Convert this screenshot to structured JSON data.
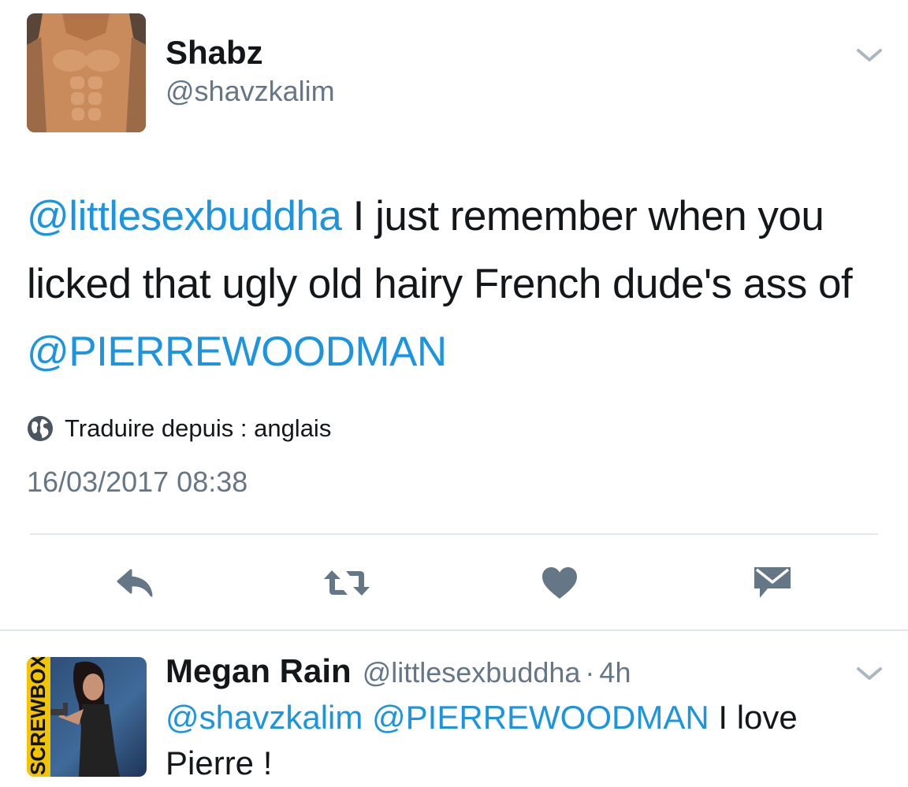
{
  "tweet": {
    "author_name": "Shabz",
    "author_handle": "@shavzkalim",
    "body": {
      "mention_1": "@littlesexbuddha",
      "text_1": " I just remember when you licked that ugly old hairy French dude's ass of ",
      "mention_2": "@PIERREWOODMAN"
    },
    "translate_label": "Traduire depuis : anglais",
    "timestamp": "16/03/2017 08:38",
    "actions": [
      {
        "name": "reply",
        "icon": "reply-icon"
      },
      {
        "name": "retweet",
        "icon": "retweet-icon"
      },
      {
        "name": "like",
        "icon": "heart-icon"
      },
      {
        "name": "direct-message",
        "icon": "envelope-icon"
      }
    ]
  },
  "reply": {
    "author_name": "Megan Rain",
    "author_handle": "@littlesexbuddha",
    "separator": "·",
    "time": "4h",
    "body": {
      "mention_1": "@shavzkalim",
      "mention_2": "@PIERREWOODMAN",
      "text_1": " I love Pierre !"
    },
    "avatar_side_text": "SCREWBOX"
  },
  "colors": {
    "link": "#1b95e0",
    "text": "#14171a",
    "secondary": "#657786",
    "icon": "#657786",
    "divider": "#e1e8ed"
  }
}
